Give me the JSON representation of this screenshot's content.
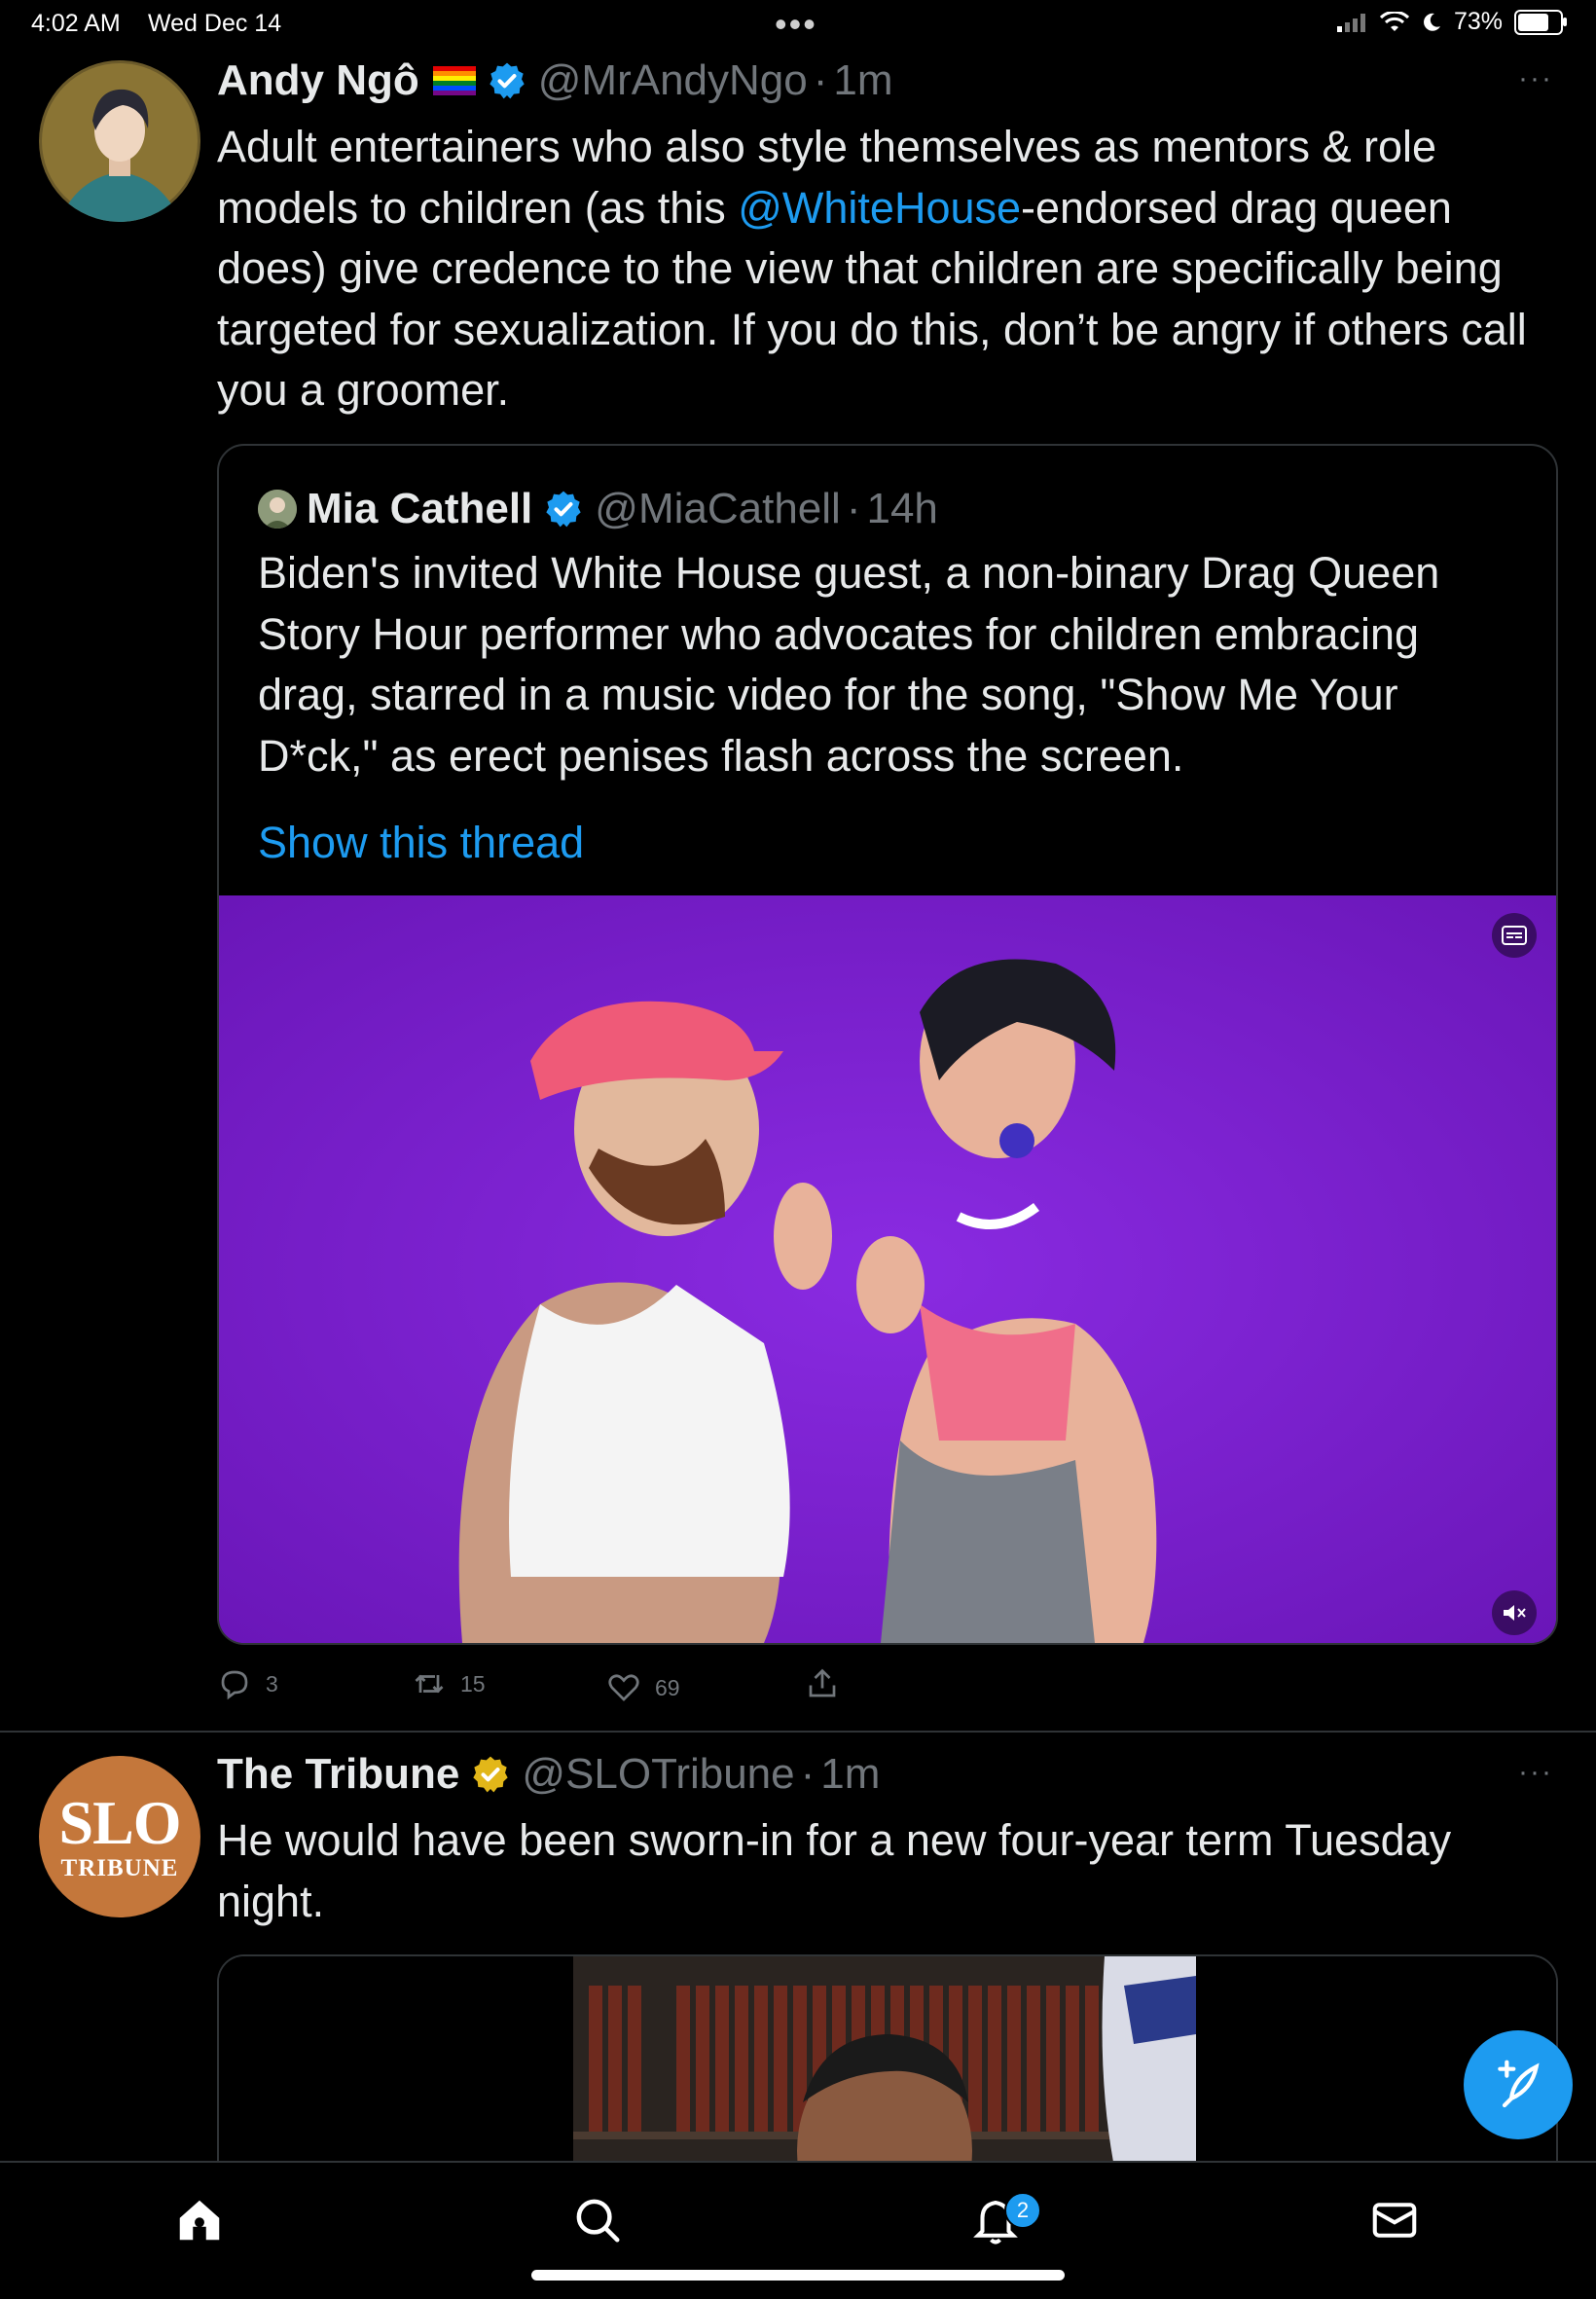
{
  "status_bar": {
    "time": "4:02 AM",
    "date": "Wed Dec 14",
    "battery": "73%"
  },
  "tweet1": {
    "name": "Andy Ngô",
    "flag_emoji": "🏳️‍🌈",
    "handle": "@MrAndyNgo",
    "sep": "·",
    "time": "1m",
    "more": "···",
    "text_before": "Adult entertainers who also style themselves as mentors & role models to children (as this ",
    "mention": "@WhiteHouse",
    "text_after": "-endorsed drag queen does) give credence to the view that children are specifically being targeted for sexualization. If you do this, don’t be angry if others call you a groomer.",
    "quote": {
      "name": "Mia Cathell",
      "handle": "@MiaCathell",
      "sep": "·",
      "time": "14h",
      "text": "Biden's invited White House guest, a non-binary Drag Queen Story Hour performer who advocates for children embracing drag, starred in a music video for the song, \"Show Me Your D*ck,\" as erect penises flash across the screen.",
      "show_thread": "Show this thread"
    },
    "actions": {
      "replies": "3",
      "retweets": "15",
      "likes": "69"
    }
  },
  "tweet2": {
    "name": "The Tribune",
    "handle": "@SLOTribune",
    "sep": "·",
    "time": "1m",
    "more": "···",
    "text": "He would have been sworn-in for a new four-year term Tuesday night.",
    "logo_top": "SLO",
    "logo_bottom": "TRIBUNE"
  },
  "tabbar": {
    "notifications_badge": "2"
  },
  "icons": [
    "home-icon",
    "search-icon",
    "bell-icon",
    "mail-icon",
    "compose-icon",
    "reply-icon",
    "retweet-icon",
    "like-icon",
    "share-icon",
    "verified-icon",
    "mute-icon",
    "caption-icon"
  ],
  "colors": {
    "accent": "#1d9bf0",
    "background": "#000000",
    "muted": "#71767b",
    "gold_badge": "#e2b719",
    "tribune": "#c4773b",
    "video_bg": "#7a1fc6"
  }
}
